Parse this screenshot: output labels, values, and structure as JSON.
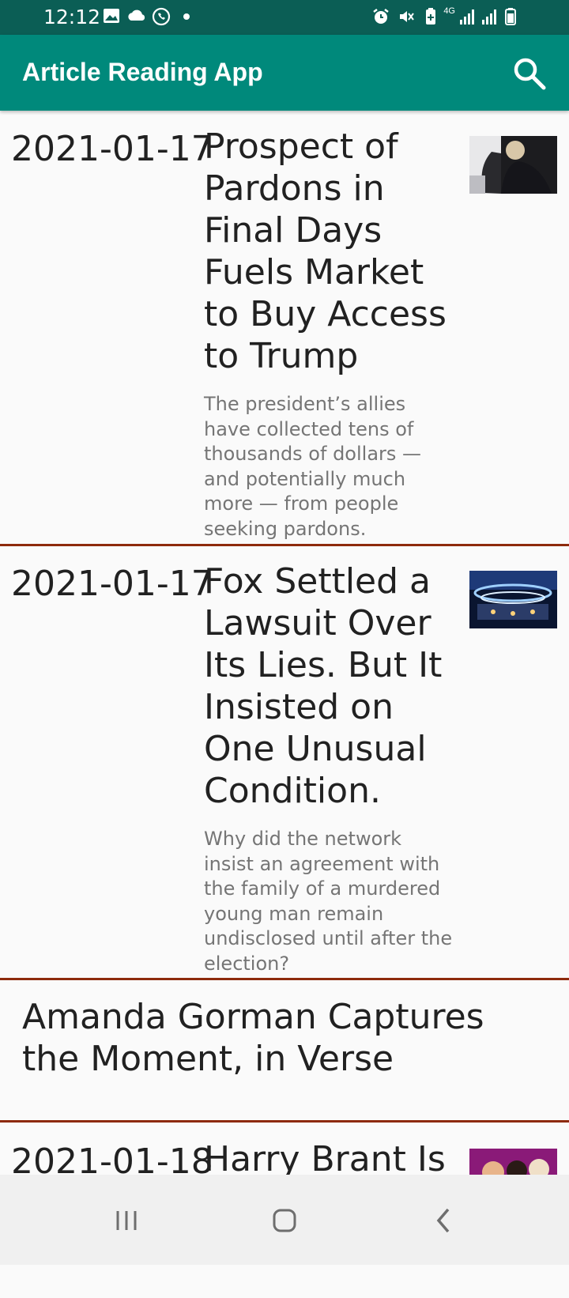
{
  "status_bar": {
    "time": "12:12",
    "left_icons": [
      "gallery-icon",
      "cloud-icon",
      "whatsapp-icon",
      "dot-icon"
    ],
    "right_icons": [
      "alarm-icon",
      "mute-icon",
      "battery-saver-icon",
      "4g-icon",
      "signal-icon",
      "signal-icon",
      "battery-icon"
    ],
    "network_label": "4G"
  },
  "app_bar": {
    "title": "Article Reading App",
    "search_icon": "search-icon"
  },
  "articles": [
    {
      "date": "2021-01-17",
      "headline": "Prospect of Pardons in Final Days Fuels Market to Buy Access to Trump",
      "abstract": "The president’s allies have collected tens of thousands of dollars — and potentially much more — from people seeking pardons."
    },
    {
      "date": "2021-01-17",
      "headline": "Fox Settled a Lawsuit Over Its Lies. But It Insisted on One Unusual Condition.",
      "abstract": "Why did the network insist an agreement with the family of a murdered young man remain undisclosed until after the election?"
    },
    {
      "date": "",
      "headline": "Amanda Gorman Captures the Moment, in Verse",
      "abstract": ""
    },
    {
      "date": "2021-01-18",
      "headline": "Harry Brant Is",
      "abstract": ""
    }
  ],
  "colors": {
    "status_bar": "#0b5e55",
    "app_bar": "#00897b",
    "divider": "#8d2a0c",
    "background": "#fafafa"
  },
  "nav_bar": {
    "buttons": [
      "recents-icon",
      "home-icon",
      "back-icon"
    ]
  }
}
